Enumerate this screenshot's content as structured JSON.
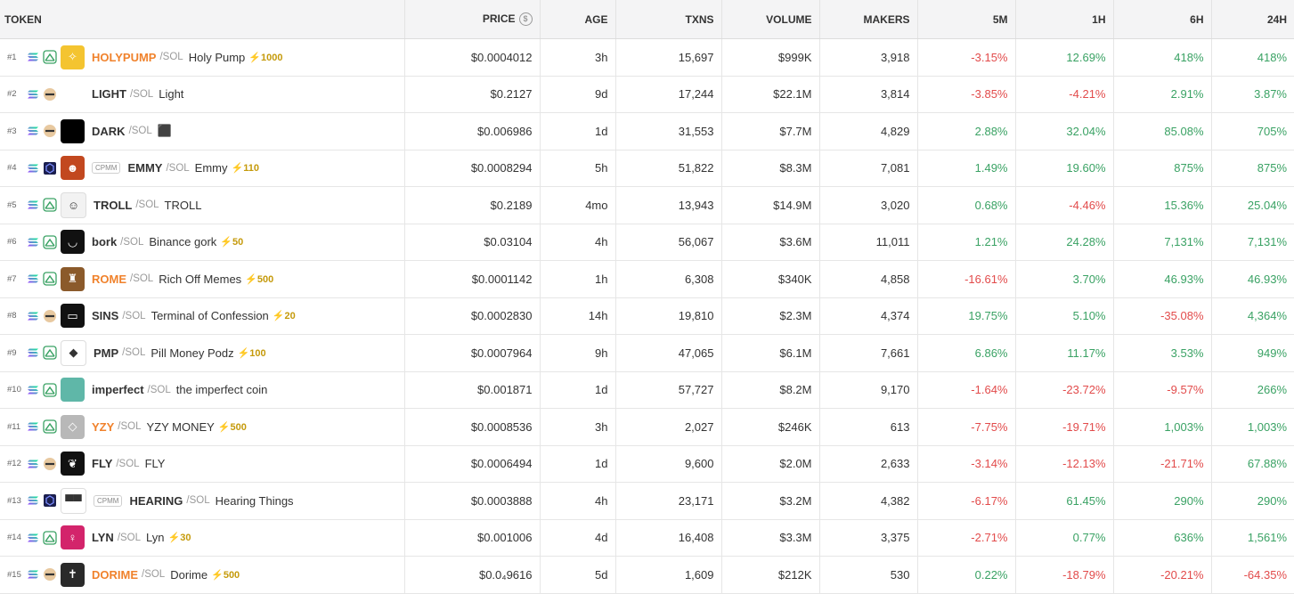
{
  "headers": {
    "token": "TOKEN",
    "price": "PRICE",
    "price_icon": "dollar-circle-icon",
    "age": "AGE",
    "txns": "TXNS",
    "volume": "VOLUME",
    "makers": "MAKERS",
    "m5": "5M",
    "h1": "1H",
    "h6": "6H",
    "h24": "24H"
  },
  "colors": {
    "positive": "#3aa264",
    "negative": "#e24b4b",
    "highlight_symbol": "#f0822c",
    "boost": "#c59a0b"
  },
  "rows": [
    {
      "rank": "#1",
      "dex": "pumpswap-icon",
      "avatar_color": "#f4c430",
      "avatar_icon": "gold-emblem-icon",
      "cpmm": "",
      "symbol": "HOLYPUMP",
      "orange": true,
      "quote": "/SOL",
      "name": "Holy Pump",
      "boost": "⚡1000",
      "price": "$0.0004012",
      "age": "3h",
      "txns": "15,697",
      "volume": "$999K",
      "makers": "3,918",
      "m5": "-3.15%",
      "h1": "12.69%",
      "h6": "418%",
      "h24": "418%"
    },
    {
      "rank": "#2",
      "dex": "meteora-icon",
      "avatar_color": "",
      "avatar_icon": "",
      "cpmm": "",
      "symbol": "LIGHT",
      "orange": false,
      "quote": "/SOL",
      "name": "Light",
      "boost": "",
      "price": "$0.2127",
      "age": "9d",
      "txns": "17,244",
      "volume": "$22.1M",
      "makers": "3,814",
      "m5": "-3.85%",
      "h1": "-4.21%",
      "h6": "2.91%",
      "h24": "3.87%"
    },
    {
      "rank": "#3",
      "dex": "meteora-icon",
      "avatar_color": "#000000",
      "avatar_icon": "",
      "cpmm": "",
      "symbol": "DARK",
      "orange": false,
      "quote": "/SOL",
      "name": "⬛",
      "boost": "",
      "price": "$0.006986",
      "age": "1d",
      "txns": "31,553",
      "volume": "$7.7M",
      "makers": "4,829",
      "m5": "2.88%",
      "h1": "32.04%",
      "h6": "85.08%",
      "h24": "705%"
    },
    {
      "rank": "#4",
      "dex": "raydium-icon",
      "avatar_color": "#c2481f",
      "avatar_icon": "character-icon",
      "cpmm": "CPMM",
      "symbol": "EMMY",
      "orange": false,
      "quote": "/SOL",
      "name": "Emmy",
      "boost": "⚡110",
      "price": "$0.0008294",
      "age": "5h",
      "txns": "51,822",
      "volume": "$8.3M",
      "makers": "7,081",
      "m5": "1.49%",
      "h1": "19.60%",
      "h6": "875%",
      "h24": "875%"
    },
    {
      "rank": "#5",
      "dex": "pumpswap-icon",
      "avatar_color": "#f2f2f2",
      "avatar_icon": "trollface-icon",
      "cpmm": "",
      "symbol": "TROLL",
      "orange": false,
      "quote": "/SOL",
      "name": "TROLL",
      "boost": "",
      "price": "$0.2189",
      "age": "4mo",
      "txns": "13,943",
      "volume": "$14.9M",
      "makers": "3,020",
      "m5": "0.68%",
      "h1": "-4.46%",
      "h6": "15.36%",
      "h24": "25.04%"
    },
    {
      "rank": "#6",
      "dex": "pumpswap-icon",
      "avatar_color": "#111111",
      "avatar_icon": "smile-icon",
      "cpmm": "",
      "symbol": "bork",
      "orange": false,
      "quote": "/SOL",
      "name": "Binance gork",
      "boost": "⚡50",
      "price": "$0.03104",
      "age": "4h",
      "txns": "56,067",
      "volume": "$3.6M",
      "makers": "11,011",
      "m5": "1.21%",
      "h1": "24.28%",
      "h6": "7,131%",
      "h24": "7,131%"
    },
    {
      "rank": "#7",
      "dex": "pumpswap-icon",
      "avatar_color": "#8b5a2b",
      "avatar_icon": "statue-icon",
      "cpmm": "",
      "symbol": "ROME",
      "orange": true,
      "quote": "/SOL",
      "name": "Rich Off Memes",
      "boost": "⚡500",
      "price": "$0.0001142",
      "age": "1h",
      "txns": "6,308",
      "volume": "$340K",
      "makers": "4,858",
      "m5": "-16.61%",
      "h1": "3.70%",
      "h6": "46.93%",
      "h24": "46.93%"
    },
    {
      "rank": "#8",
      "dex": "meteora-icon",
      "avatar_color": "#111111",
      "avatar_icon": "terminal-icon",
      "cpmm": "",
      "symbol": "SINS",
      "orange": false,
      "quote": "/SOL",
      "name": "Terminal of Confession",
      "boost": "⚡20",
      "price": "$0.0002830",
      "age": "14h",
      "txns": "19,810",
      "volume": "$2.3M",
      "makers": "4,374",
      "m5": "19.75%",
      "h1": "5.10%",
      "h6": "-35.08%",
      "h24": "4,364%"
    },
    {
      "rank": "#9",
      "dex": "pumpswap-icon",
      "avatar_color": "#ffffff",
      "avatar_icon": "pill-icon",
      "cpmm": "",
      "symbol": "PMP",
      "orange": false,
      "quote": "/SOL",
      "name": "Pill Money Podz",
      "boost": "⚡100",
      "price": "$0.0007964",
      "age": "9h",
      "txns": "47,065",
      "volume": "$6.1M",
      "makers": "7,661",
      "m5": "6.86%",
      "h1": "11.17%",
      "h6": "3.53%",
      "h24": "949%"
    },
    {
      "rank": "#10",
      "dex": "pumpswap-icon",
      "avatar_color": "#5fb7a8",
      "avatar_icon": "circle-icon",
      "cpmm": "",
      "symbol": "imperfect",
      "orange": false,
      "quote": "/SOL",
      "name": "the imperfect coin",
      "boost": "",
      "price": "$0.001871",
      "age": "1d",
      "txns": "57,727",
      "volume": "$8.2M",
      "makers": "9,170",
      "m5": "-1.64%",
      "h1": "-23.72%",
      "h6": "-9.57%",
      "h24": "266%"
    },
    {
      "rank": "#11",
      "dex": "pumpswap-icon",
      "avatar_color": "#b8b8b8",
      "avatar_icon": "yzy-logo-icon",
      "cpmm": "",
      "symbol": "YZY",
      "orange": true,
      "quote": "/SOL",
      "name": "YZY MONEY",
      "boost": "⚡500",
      "price": "$0.0008536",
      "age": "3h",
      "txns": "2,027",
      "volume": "$246K",
      "makers": "613",
      "m5": "-7.75%",
      "h1": "-19.71%",
      "h6": "1,003%",
      "h24": "1,003%"
    },
    {
      "rank": "#12",
      "dex": "meteora-icon",
      "avatar_color": "#111111",
      "avatar_icon": "feather-icon",
      "cpmm": "",
      "symbol": "FLY",
      "orange": false,
      "quote": "/SOL",
      "name": "FLY",
      "boost": "",
      "price": "$0.0006494",
      "age": "1d",
      "txns": "9,600",
      "volume": "$2.0M",
      "makers": "2,633",
      "m5": "-3.14%",
      "h1": "-12.13%",
      "h6": "-21.71%",
      "h24": "67.88%"
    },
    {
      "rank": "#13",
      "dex": "raydium-icon",
      "avatar_color": "#ffffff",
      "avatar_icon": "sunglasses-icon",
      "cpmm": "CPMM",
      "symbol": "HEARING",
      "orange": false,
      "quote": "/SOL",
      "name": "Hearing Things",
      "boost": "",
      "price": "$0.0003888",
      "age": "4h",
      "txns": "23,171",
      "volume": "$3.2M",
      "makers": "4,382",
      "m5": "-6.17%",
      "h1": "61.45%",
      "h6": "290%",
      "h24": "290%"
    },
    {
      "rank": "#14",
      "dex": "pumpswap-icon",
      "avatar_color": "#d3246b",
      "avatar_icon": "anime-girl-icon",
      "cpmm": "",
      "symbol": "LYN",
      "orange": false,
      "quote": "/SOL",
      "name": "Lyn",
      "boost": "⚡30",
      "price": "$0.001006",
      "age": "4d",
      "txns": "16,408",
      "volume": "$3.3M",
      "makers": "3,375",
      "m5": "-2.71%",
      "h1": "0.77%",
      "h6": "636%",
      "h24": "1,561%"
    },
    {
      "rank": "#15",
      "dex": "meteora-icon",
      "avatar_color": "#2a2a2a",
      "avatar_icon": "dorime-icon",
      "cpmm": "",
      "symbol": "DORIME",
      "orange": true,
      "quote": "/SOL",
      "name": "Dorime",
      "boost": "⚡500",
      "price": "$0.0₄9616",
      "age": "5d",
      "txns": "1,609",
      "volume": "$212K",
      "makers": "530",
      "m5": "0.22%",
      "h1": "-18.79%",
      "h6": "-20.21%",
      "h24": "-64.35%"
    }
  ]
}
